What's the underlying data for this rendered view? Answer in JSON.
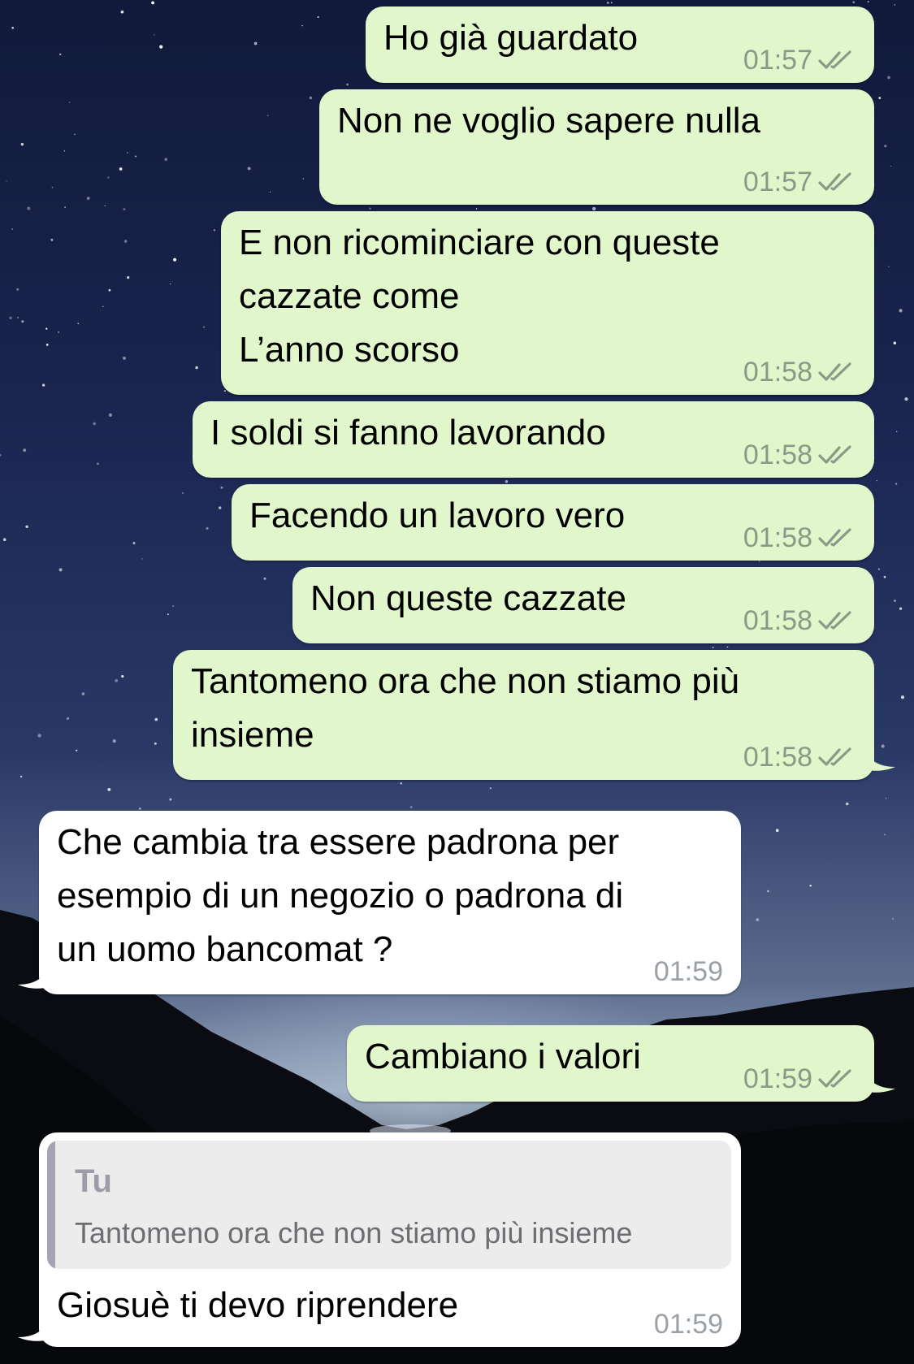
{
  "messages": [
    {
      "text": "Ho già guardato",
      "time": "01:57"
    },
    {
      "text": "Non ne voglio sapere nulla",
      "time": "01:57"
    },
    {
      "text": "E non ricominciare con queste\ncazzate come\nL’anno scorso",
      "time": "01:58"
    },
    {
      "text": "I soldi si fanno lavorando",
      "time": "01:58"
    },
    {
      "text": "Facendo un lavoro vero",
      "time": "01:58"
    },
    {
      "text": "Non queste cazzate",
      "time": "01:58"
    },
    {
      "text": "Tantomeno ora che non stiamo più\ninsieme",
      "time": "01:58"
    },
    {
      "text": "Che cambia tra essere padrona per\nesempio di un negozio o padrona di\nun uomo bancomat ?",
      "time": "01:59"
    },
    {
      "text": "Cambiano i valori",
      "time": "01:59"
    },
    {
      "text": "Giosuè ti devo riprendere",
      "time": "01:59",
      "reply": {
        "author": "Tu",
        "text": "Tantomeno ora che non stiamo più insieme"
      }
    }
  ],
  "colors": {
    "outgoing_bubble": "#e1f7cb",
    "incoming_bubble": "#ffffff",
    "timestamp_out": "#8a9a86",
    "timestamp_in": "#9aa0a6",
    "quote_background": "#ececed",
    "quote_bar": "#a8a3b3"
  },
  "icons": {
    "read_receipt": "double-check-icon"
  }
}
